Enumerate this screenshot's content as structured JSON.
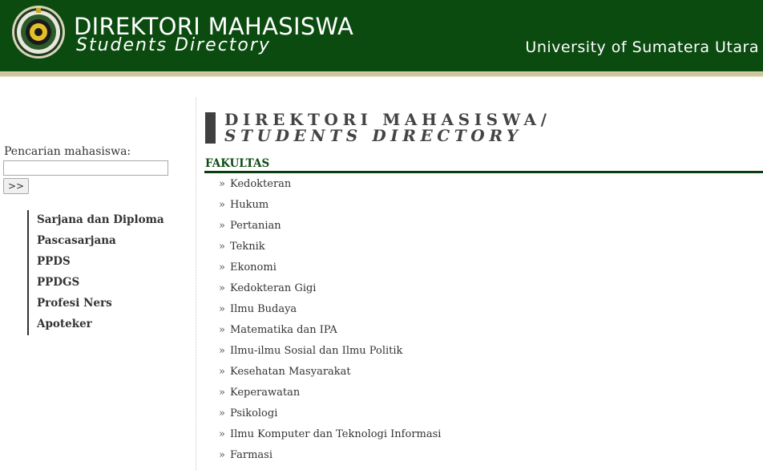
{
  "header": {
    "title": "DIREKTORI MAHASISWA",
    "subtitle": "Students Directory",
    "university": "University of Sumatera Utara",
    "colors": {
      "header_bg": "#0b4b10",
      "accent_bar": "#c8c096"
    },
    "logo_icon": "usu-emblem-icon"
  },
  "search": {
    "label": "Pencarian mahasiswa:",
    "value": "",
    "button_label": ">>"
  },
  "sidebar": {
    "items": [
      {
        "label": "Sarjana dan Diploma"
      },
      {
        "label": "Pascasarjana"
      },
      {
        "label": "PPDS"
      },
      {
        "label": "PPDGS"
      },
      {
        "label": "Profesi Ners"
      },
      {
        "label": "Apoteker"
      }
    ]
  },
  "main": {
    "heading_line1": "DIREKTORI MAHASISWA/",
    "heading_line2": "STUDENTS DIRECTORY",
    "section_title": "FAKULTAS",
    "bullet": "»",
    "faculties": [
      "Kedokteran",
      "Hukum",
      "Pertanian",
      "Teknik",
      "Ekonomi",
      "Kedokteran Gigi",
      "Ilmu Budaya",
      "Matematika dan IPA",
      "Ilmu-ilmu Sosial dan Ilmu Politik",
      "Kesehatan Masyarakat",
      "Keperawatan",
      "Psikologi",
      "Ilmu Komputer dan Teknologi Informasi",
      "Farmasi"
    ]
  }
}
